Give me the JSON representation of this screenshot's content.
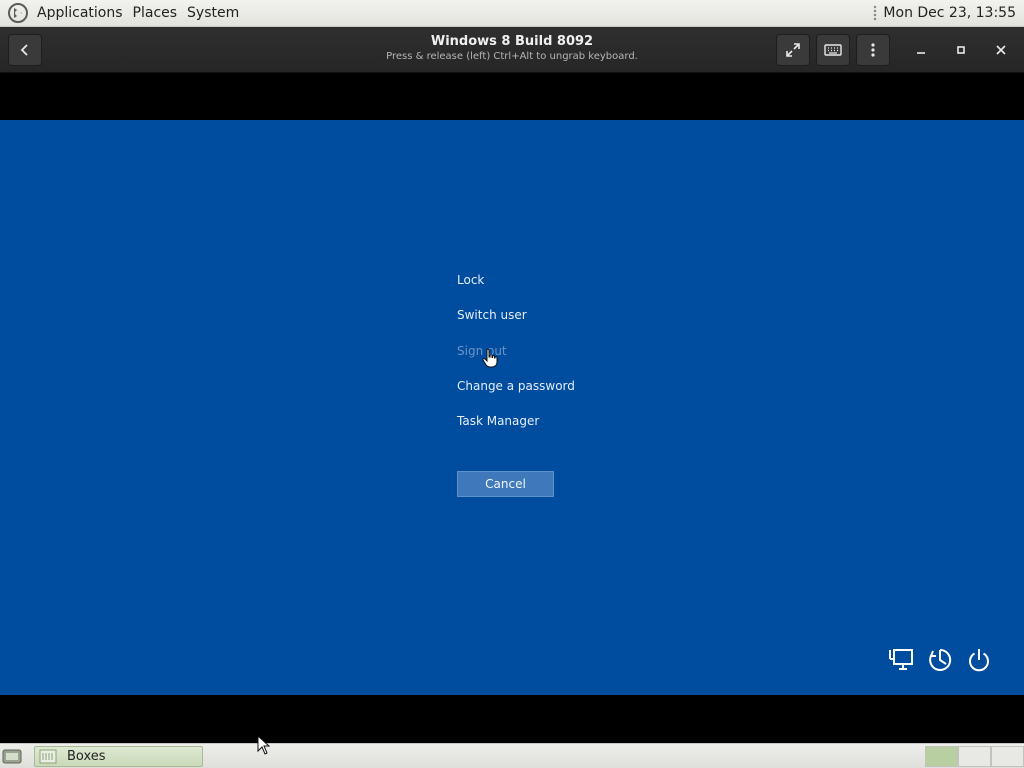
{
  "top_panel": {
    "menus": [
      "Applications",
      "Places",
      "System"
    ],
    "clock": "Mon Dec 23, 13:55"
  },
  "headerbar": {
    "title": "Windows 8 Build 8092",
    "subtitle": "Press & release (left) Ctrl+Alt to ungrab keyboard."
  },
  "vm": {
    "options": [
      "Lock",
      "Switch user",
      "Sign out",
      "Change a password",
      "Task Manager"
    ],
    "hovered_option": "Sign out",
    "cancel_label": "Cancel",
    "background_color": "#004c9e"
  },
  "bottom_panel": {
    "task_label": "Boxes"
  },
  "icons": [
    "mate-logo-icon",
    "back-arrow-icon",
    "fullscreen-icon",
    "keyboard-icon",
    "more-menu-icon",
    "minimize-icon",
    "maximize-icon",
    "close-icon",
    "network-icon",
    "ease-of-access-icon",
    "power-icon",
    "hand-cursor-icon",
    "show-desktop-icon",
    "boxes-app-icon",
    "arrow-cursor-icon"
  ]
}
